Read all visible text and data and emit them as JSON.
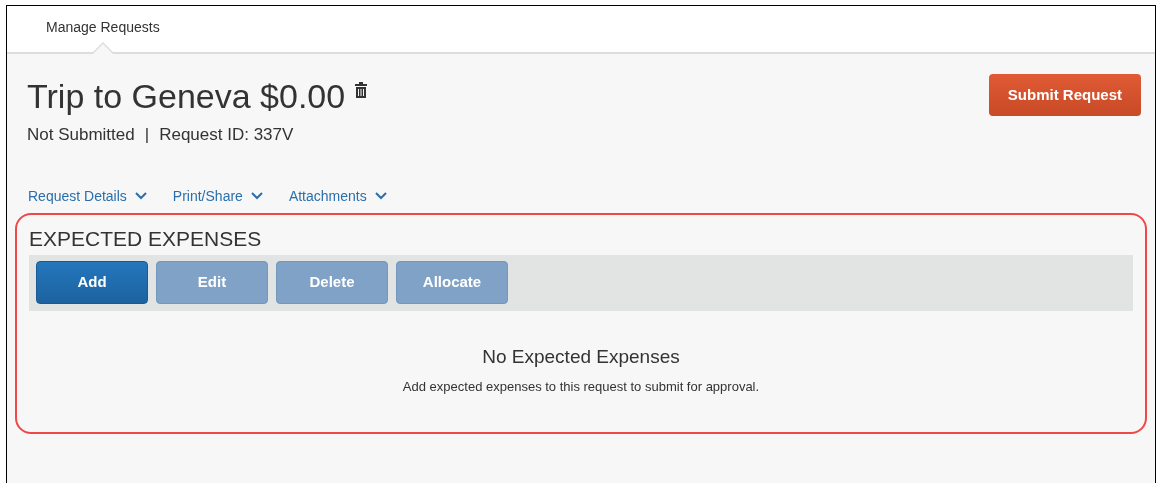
{
  "nav_tabs": [
    {
      "label": "Manage Requests",
      "selected": true
    }
  ],
  "request": {
    "title": "Trip to Geneva $0.00",
    "status": "Not Submitted",
    "separator": "|",
    "request_id": "Request ID: 337V"
  },
  "submit_button": "Submit Request",
  "menus": [
    {
      "label": "Request Details"
    },
    {
      "label": "Print/Share"
    },
    {
      "label": "Attachments"
    }
  ],
  "expected_expenses": {
    "heading": "EXPECTED EXPENSES",
    "buttons": [
      {
        "label": "Add",
        "disabled": false
      },
      {
        "label": "Edit",
        "disabled": true
      },
      {
        "label": "Delete",
        "disabled": true
      },
      {
        "label": "Allocate",
        "disabled": true
      }
    ],
    "empty_title": "No Expected Expenses",
    "empty_message": "Add expected expenses to this request to submit for approval."
  }
}
